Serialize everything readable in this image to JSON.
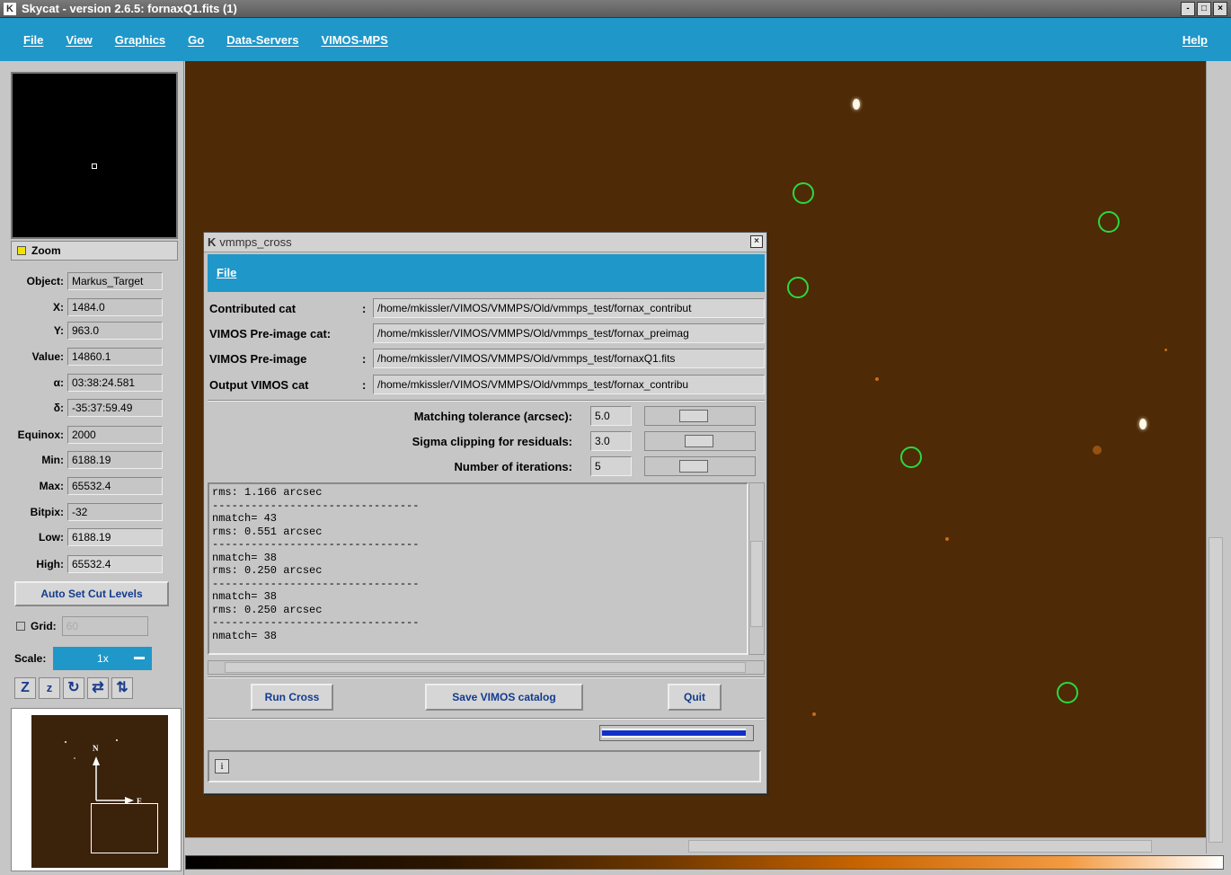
{
  "window": {
    "title": "Skycat - version 2.6.5: fornaxQ1.fits (1)",
    "controls": [
      "-",
      "□",
      "×"
    ]
  },
  "menubar": {
    "items": [
      "File",
      "View",
      "Graphics",
      "Go",
      "Data-Servers",
      "VIMOS-MPS"
    ],
    "help": "Help"
  },
  "left_panel": {
    "zoom_label": "Zoom",
    "fields": [
      {
        "label": "Object:",
        "value": "Markus_Target"
      },
      {
        "label": "X:",
        "value": "1484.0"
      },
      {
        "label": "Y:",
        "value": "963.0"
      },
      {
        "label": "Value:",
        "value": "14860.1"
      },
      {
        "label": "α:",
        "value": "03:38:24.581"
      },
      {
        "label": "δ:",
        "value": "-35:37:59.49"
      },
      {
        "label": "Equinox:",
        "value": "2000"
      },
      {
        "label": "Min:",
        "value": "6188.19"
      },
      {
        "label": "Max:",
        "value": "65532.4"
      },
      {
        "label": "Bitpix:",
        "value": "-32"
      },
      {
        "label": "Low:",
        "value": "6188.19"
      },
      {
        "label": "High:",
        "value": "65532.4"
      }
    ],
    "auto_set_label": "Auto Set Cut Levels",
    "grid_label": "Grid:",
    "grid_value": "60",
    "scale_label": "Scale:",
    "scale_value": "1x",
    "zoom_icons": [
      "Z",
      "z",
      "↻",
      "⇄",
      "⇅"
    ],
    "compass": {
      "north": "N",
      "east": "E"
    }
  },
  "dialog": {
    "title": "vmmps_cross",
    "menu_file": "File",
    "catalogs": [
      {
        "label": "Contributed cat",
        "colon": ":",
        "path": "/home/mkissler/VIMOS/VMMPS/Old/vmmps_test/fornax_contribut"
      },
      {
        "label": "VIMOS Pre-image cat:",
        "colon": "",
        "path": "/home/mkissler/VIMOS/VMMPS/Old/vmmps_test/fornax_preimag"
      },
      {
        "label": "VIMOS Pre-image",
        "colon": ":",
        "path": "/home/mkissler/VIMOS/VMMPS/Old/vmmps_test/fornaxQ1.fits"
      },
      {
        "label": "Output VIMOS cat",
        "colon": ":",
        "path": "/home/mkissler/VIMOS/VMMPS/Old/vmmps_test/fornax_contribu"
      }
    ],
    "params": [
      {
        "label": "Matching tolerance (arcsec):",
        "value": "5.0"
      },
      {
        "label": "Sigma clipping for residuals:",
        "value": "3.0"
      },
      {
        "label": "Number of iterations:",
        "value": "5"
      }
    ],
    "log_lines": [
      "rms: 1.166 arcsec",
      "--------------------------------",
      "nmatch= 43",
      "rms: 0.551 arcsec",
      "--------------------------------",
      "nmatch= 38",
      "rms: 0.250 arcsec",
      "--------------------------------",
      "nmatch= 38",
      "rms: 0.250 arcsec",
      "--------------------------------",
      "nmatch= 38"
    ],
    "buttons": {
      "run": "Run Cross",
      "save": "Save VIMOS catalog",
      "quit": "Quit"
    },
    "status_icon": "i"
  }
}
